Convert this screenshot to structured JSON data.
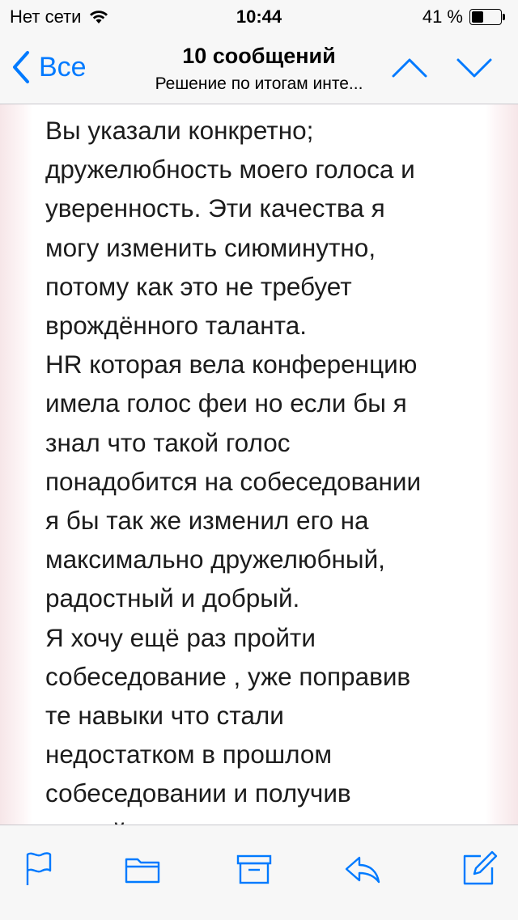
{
  "status_bar": {
    "carrier": "Нет сети",
    "time": "10:44",
    "battery_percent": "41 %",
    "battery_level": 0.41
  },
  "nav": {
    "back_label": "Все",
    "title": "10 сообщений",
    "subtitle": "Решение по итогам инте..."
  },
  "message": {
    "lines": [
      "Вы указали конкретно;",
      "дружелюбность моего голоса и",
      "уверенность. Эти качества я",
      "могу изменить сиюминутно,",
      "потому как это не требует",
      "врождённого таланта.",
      "HR которая вела конференцию",
      "имела голос феи но если бы я",
      "знал что такой голос",
      "понадобится на собеседовании",
      "я бы так же изменил его на",
      "максимально дружелюбный,",
      "радостный и добрый.",
      "Я хочу ещё раз пройти",
      "собеседование , уже поправив",
      "те навыки что стали",
      "недостатком в прошлом",
      "собеседовании и получив",
      "второй шанс"
    ]
  },
  "toolbar": {
    "icons": [
      "flag-icon",
      "folder-icon",
      "archive-icon",
      "reply-icon",
      "compose-icon"
    ]
  },
  "colors": {
    "accent": "#007aff",
    "bar_background": "#f7f7f7",
    "text": "#1c1c1c"
  }
}
